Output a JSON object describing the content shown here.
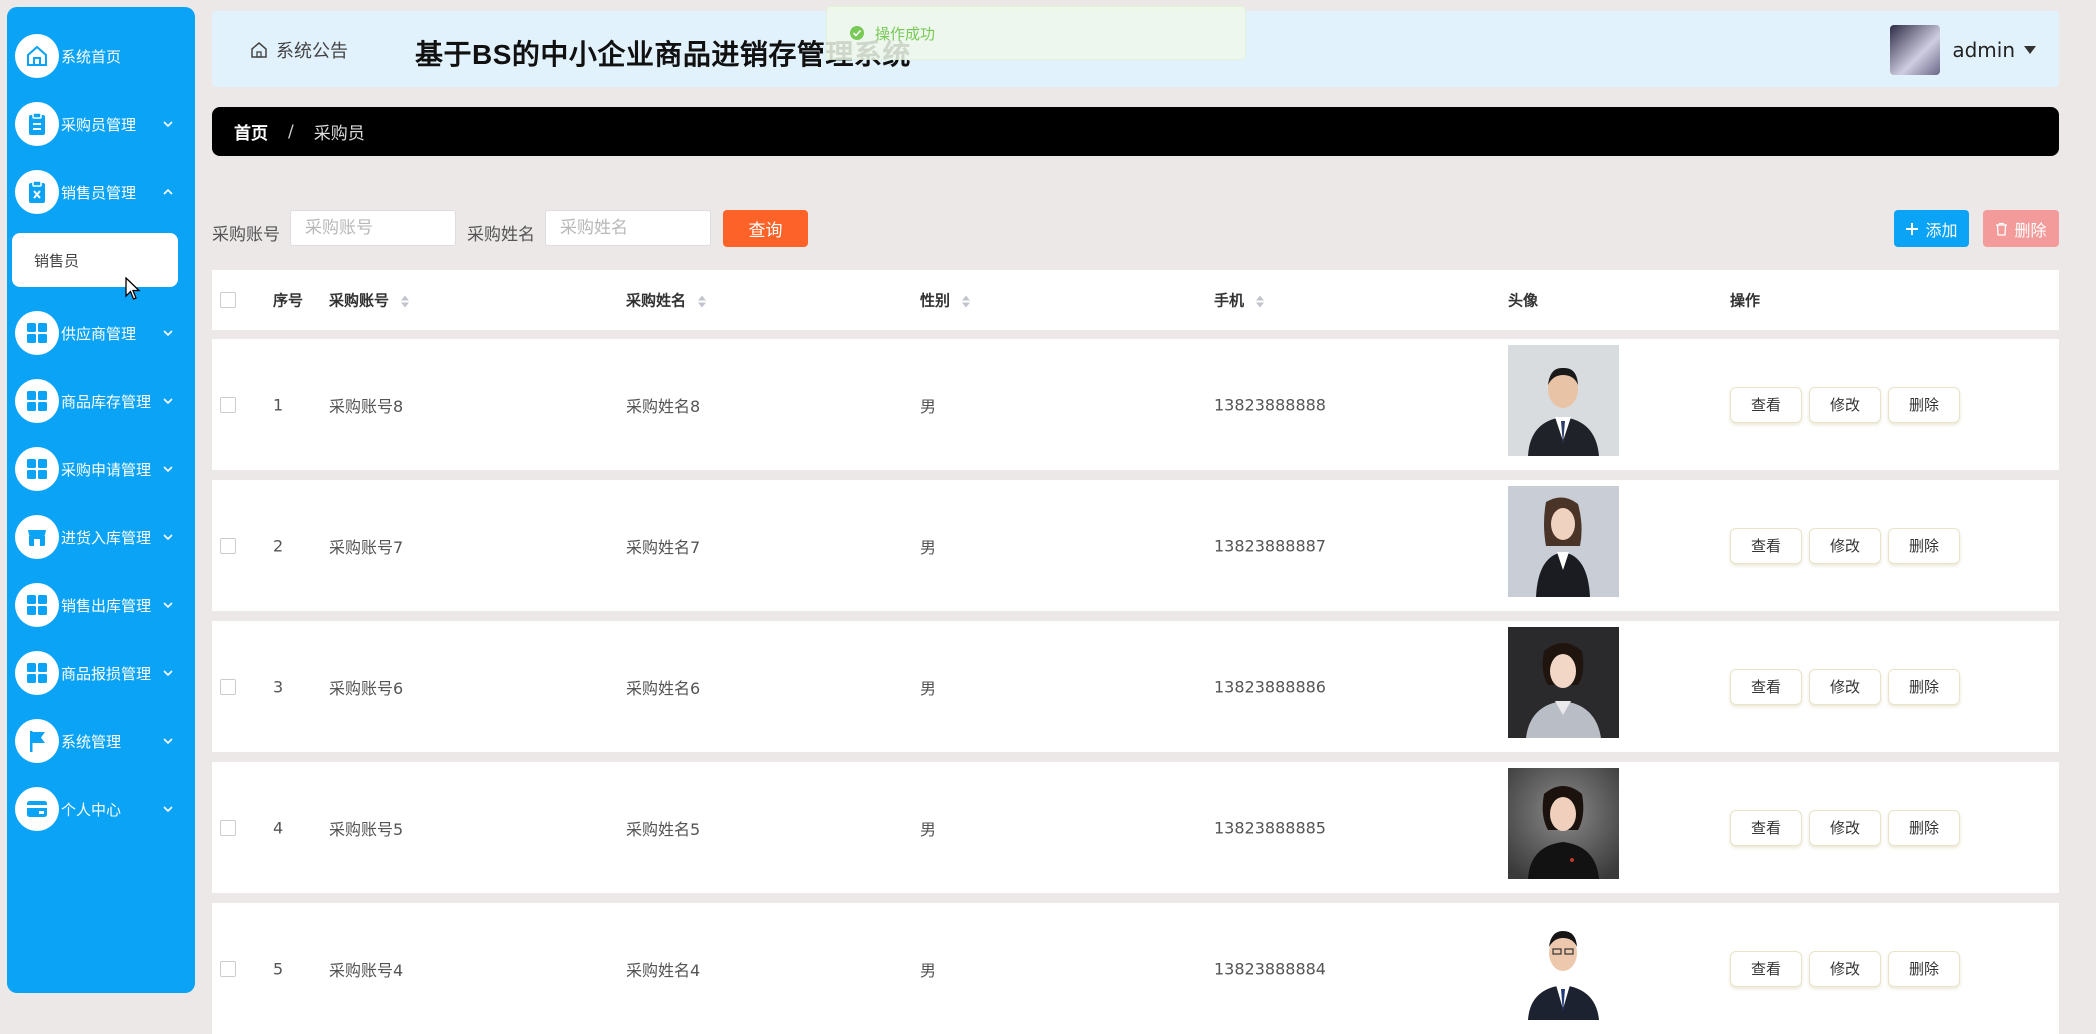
{
  "sidebar": {
    "items": [
      {
        "label": "系统首页",
        "icon": "home-icon",
        "expanded": false
      },
      {
        "label": "采购员管理",
        "icon": "clipboard-icon",
        "expanded": false
      },
      {
        "label": "销售员管理",
        "icon": "clipboard-x-icon",
        "expanded": true
      },
      {
        "label": "供应商管理",
        "icon": "grid-icon",
        "expanded": false
      },
      {
        "label": "商品库存管理",
        "icon": "grid-icon",
        "expanded": false
      },
      {
        "label": "采购申请管理",
        "icon": "grid-icon",
        "expanded": false
      },
      {
        "label": "进货入库管理",
        "icon": "shop-icon",
        "expanded": false
      },
      {
        "label": "销售出库管理",
        "icon": "grid-icon",
        "expanded": false
      },
      {
        "label": "商品报损管理",
        "icon": "grid-icon",
        "expanded": false
      },
      {
        "label": "系统管理",
        "icon": "flag-icon",
        "expanded": false
      },
      {
        "label": "个人中心",
        "icon": "card-icon",
        "expanded": false
      }
    ],
    "sub_item": "销售员"
  },
  "header": {
    "notice": "系统公告",
    "title": "基于BS的中小企业商品进销存管理系统",
    "user": "admin"
  },
  "toast": "操作成功",
  "breadcrumb": {
    "home": "首页",
    "separator": "/",
    "current": "采购员"
  },
  "search": {
    "account_label": "采购账号",
    "account_placeholder": "采购账号",
    "name_label": "采购姓名",
    "name_placeholder": "采购姓名",
    "query": "查询",
    "add": "添加",
    "delete": "删除"
  },
  "table": {
    "columns": [
      "序号",
      "采购账号",
      "采购姓名",
      "性别",
      "手机",
      "头像",
      "操作"
    ],
    "rows": [
      {
        "index": "1",
        "account": "采购账号8",
        "name": "采购姓名8",
        "gender": "男",
        "phone": "13823888888"
      },
      {
        "index": "2",
        "account": "采购账号7",
        "name": "采购姓名7",
        "gender": "男",
        "phone": "13823888887"
      },
      {
        "index": "3",
        "account": "采购账号6",
        "name": "采购姓名6",
        "gender": "男",
        "phone": "13823888886"
      },
      {
        "index": "4",
        "account": "采购账号5",
        "name": "采购姓名5",
        "gender": "男",
        "phone": "13823888885"
      },
      {
        "index": "5",
        "account": "采购账号4",
        "name": "采购姓名4",
        "gender": "男",
        "phone": "13823888884"
      }
    ],
    "actions": {
      "view": "查看",
      "edit": "修改",
      "delete": "删除"
    }
  },
  "colors": {
    "primary": "#0aa3f5",
    "query_button": "#fd6329",
    "delete_button": "#f39a9a",
    "breadcrumb_bg": "#000000",
    "header_bg": "#e2f2fc",
    "success": "#67c23a"
  }
}
